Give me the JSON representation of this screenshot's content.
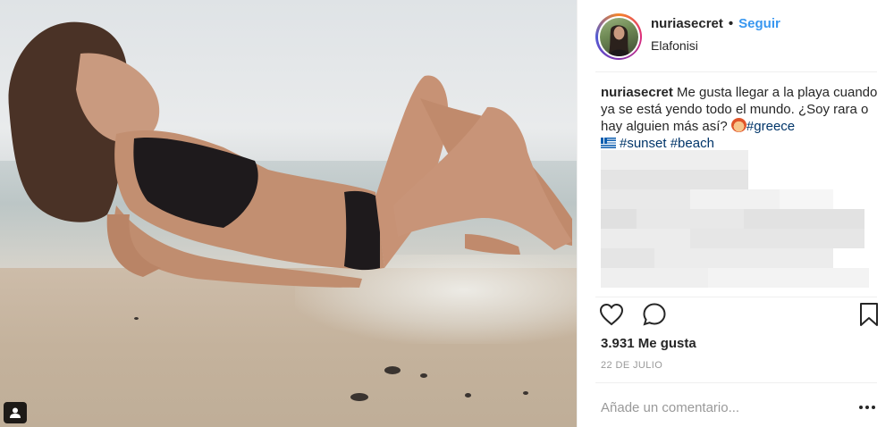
{
  "post": {
    "username": "nuriasecret",
    "separator": "•",
    "follow_label": "Seguir",
    "location": "Elafonisi",
    "caption": {
      "username": "nuriasecret",
      "text_line1": " Me gusta llegar a la playa cuando ya se está yendo todo el mundo. ¿Soy rara o hay alguien más así? ",
      "emoji_face": "woman-red-hair-emoji",
      "hashtag_greece": "#greece",
      "flag_emoji": "greece-flag-emoji",
      "hashtag_sunset": "#sunset",
      "hashtag_beach": "#beach"
    },
    "likes": "3.931 Me gusta",
    "date": "22 DE JULIO",
    "comment_placeholder": "Añade un comentario..."
  },
  "icons": {
    "like": "heart-icon",
    "comment": "comment-icon",
    "save": "bookmark-icon",
    "more": "more-icon",
    "tagged": "user-tag-icon"
  },
  "colors": {
    "follow": "#3897f0",
    "hashtag": "#003569",
    "meta": "#999999",
    "text": "#262626"
  }
}
